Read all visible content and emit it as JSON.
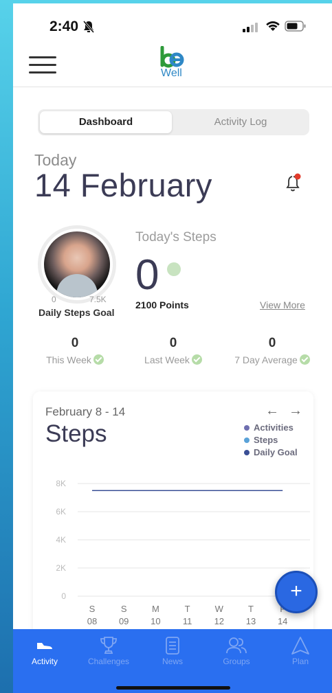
{
  "status_bar": {
    "time": "2:40"
  },
  "header": {
    "logo_text": "Well"
  },
  "segment": {
    "active": "Dashboard",
    "inactive": "Activity Log"
  },
  "date": {
    "prefix": "Today",
    "value": "14 February"
  },
  "steps_goal": {
    "min": "0",
    "max": "7.5K",
    "label": "Daily Steps Goal"
  },
  "today_steps": {
    "title": "Today's Steps",
    "value": "0",
    "points": "2100 Points",
    "view_more": "View More"
  },
  "stats": [
    {
      "value": "0",
      "label": "This Week"
    },
    {
      "value": "0",
      "label": "Last Week"
    },
    {
      "value": "0",
      "label": "7 Day Average"
    }
  ],
  "chart_card": {
    "range": "February 8 - 14",
    "title": "Steps"
  },
  "chart_data": {
    "type": "line",
    "title": "Steps",
    "categories": [
      [
        "S",
        "08"
      ],
      [
        "S",
        "09"
      ],
      [
        "M",
        "10"
      ],
      [
        "T",
        "11"
      ],
      [
        "W",
        "12"
      ],
      [
        "T",
        "13"
      ],
      [
        "F",
        "14"
      ]
    ],
    "ylim": [
      0,
      8000
    ],
    "yticks": [
      "8K",
      "6K",
      "4K",
      "2K",
      "0"
    ],
    "ytick_values": [
      8000,
      6000,
      4000,
      2000,
      0
    ],
    "grid": true,
    "legend_position": "top-right",
    "series": [
      {
        "name": "Activities",
        "color": "#6f6fb0",
        "values": [
          0,
          0,
          0,
          0,
          0,
          0,
          0
        ]
      },
      {
        "name": "Steps",
        "color": "#5aa2d8",
        "values": [
          0,
          0,
          0,
          0,
          0,
          0,
          0
        ]
      },
      {
        "name": "Daily Goal",
        "color": "#3a4f95",
        "values": [
          7500,
          7500,
          7500,
          7500,
          7500,
          7500,
          7500
        ]
      }
    ]
  },
  "tabs": [
    {
      "label": "Activity",
      "icon": "shoe-icon",
      "active": true
    },
    {
      "label": "Challenges",
      "icon": "trophy-icon",
      "active": false
    },
    {
      "label": "News",
      "icon": "news-icon",
      "active": false
    },
    {
      "label": "Groups",
      "icon": "groups-icon",
      "active": false
    },
    {
      "label": "Plan",
      "icon": "plan-icon",
      "active": false
    }
  ],
  "colors": {
    "accent": "#2a6ff0",
    "title": "#3b3b55",
    "check": "#b6dca8"
  }
}
